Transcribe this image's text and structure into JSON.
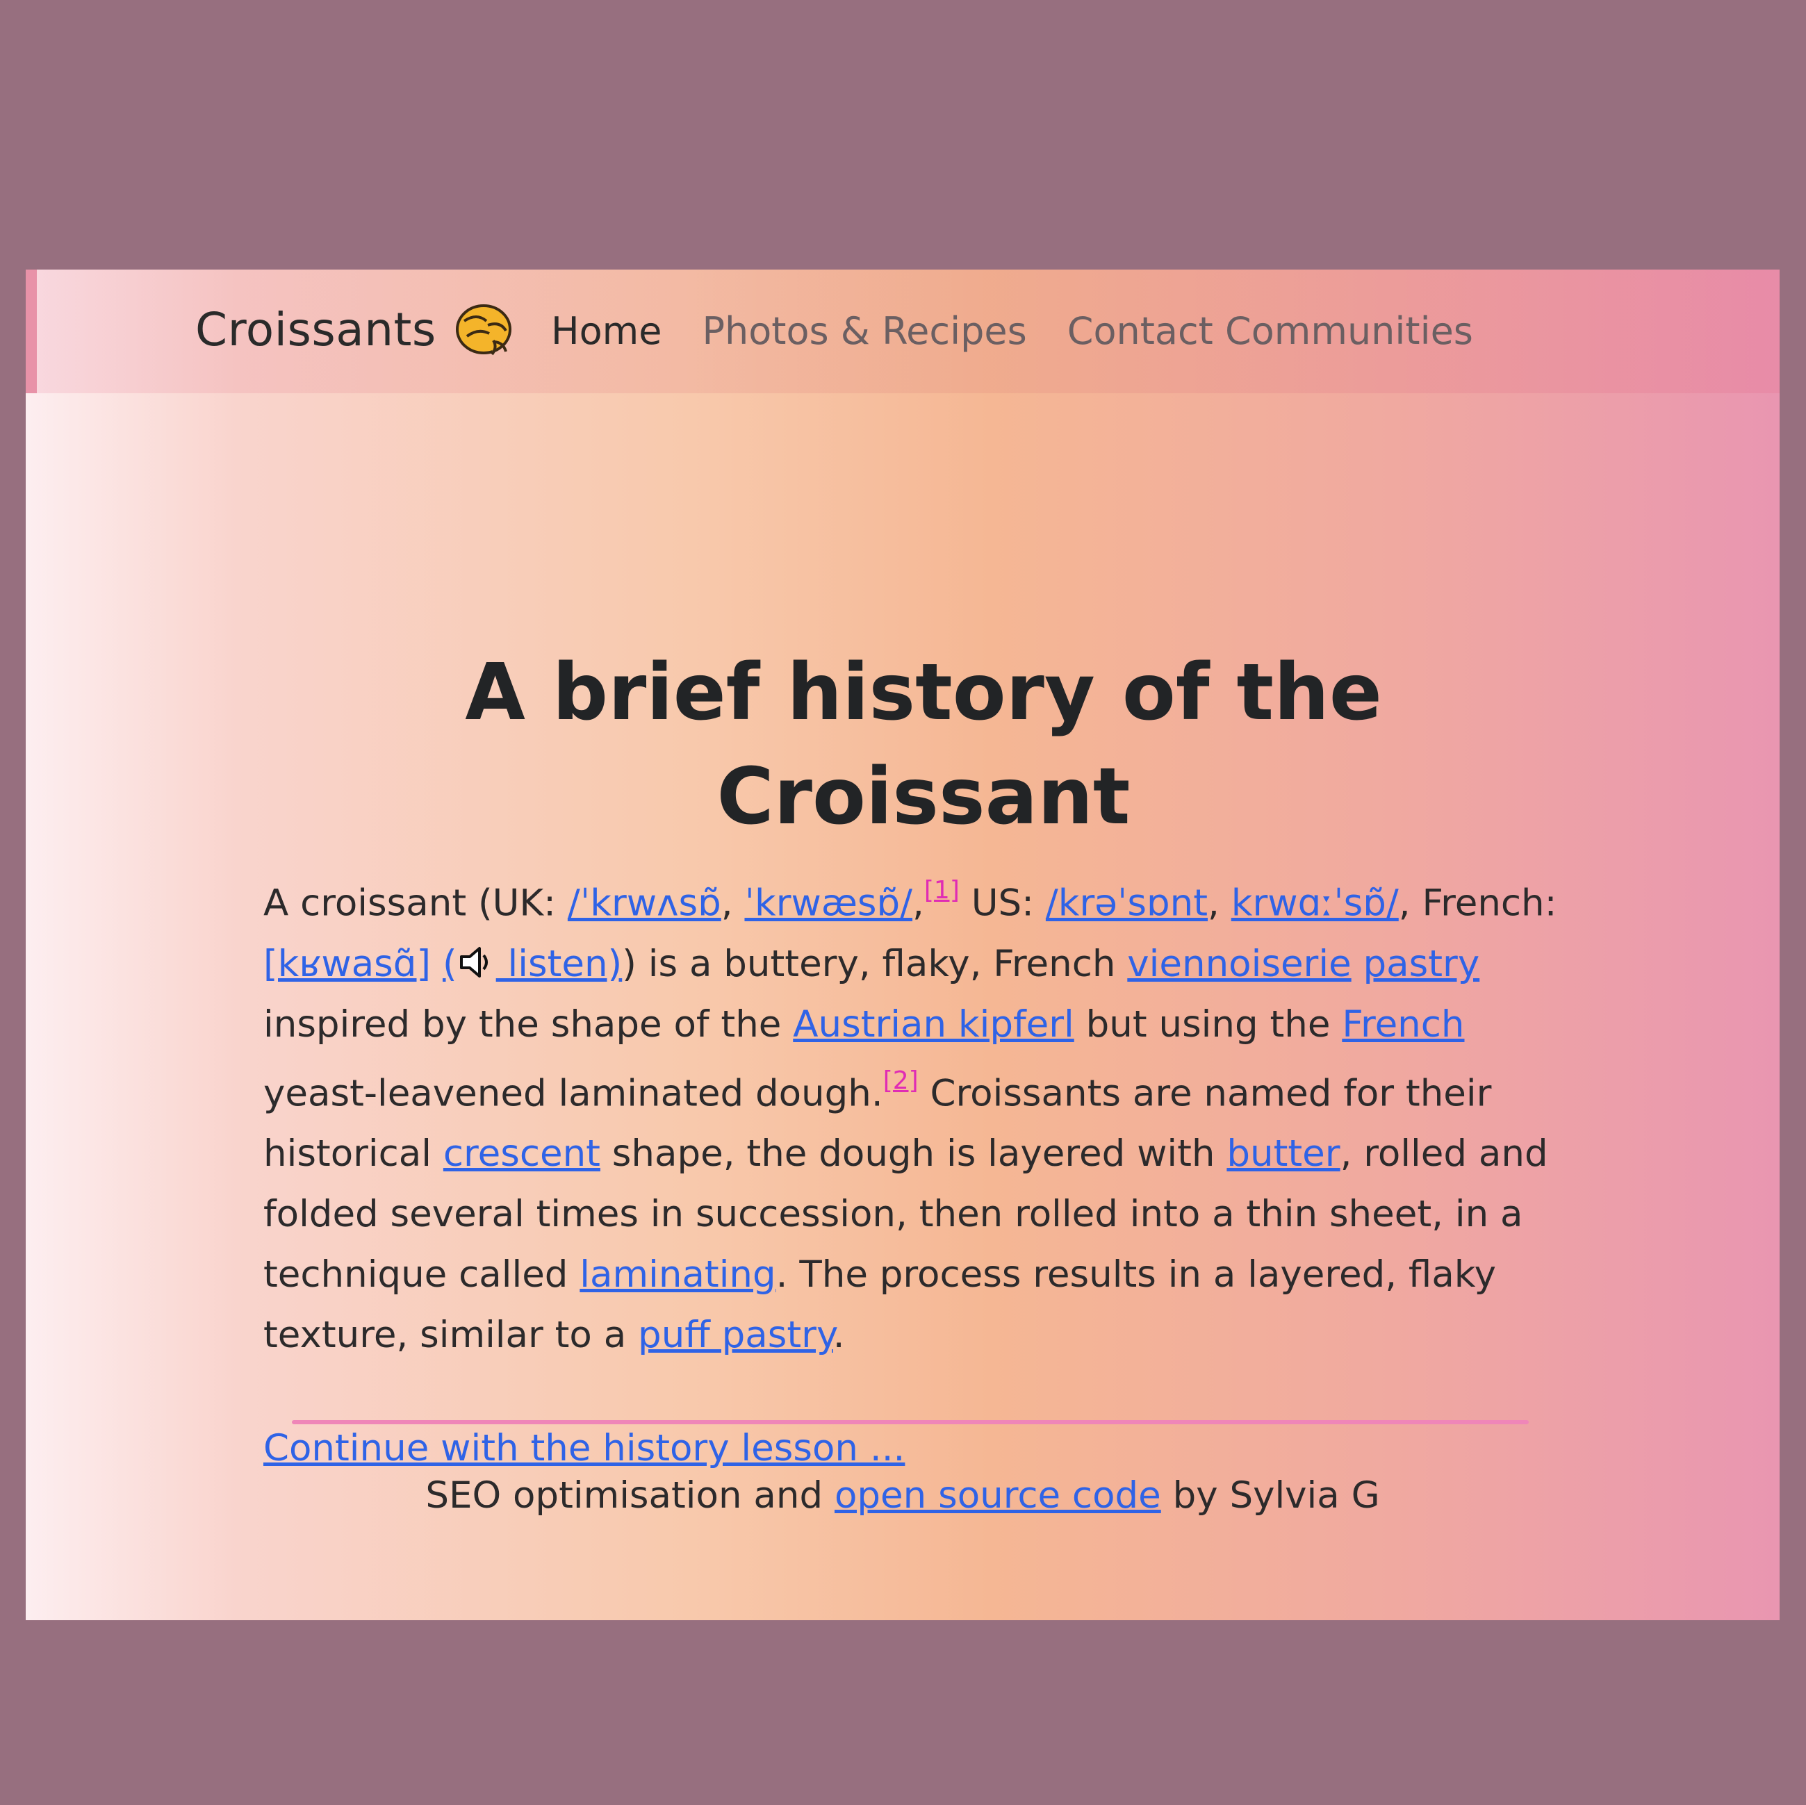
{
  "navbar": {
    "brand": "Croissants",
    "brand_icon": "croissant-icon",
    "links": [
      {
        "label": "Home",
        "active": true
      },
      {
        "label": "Photos & Recipes",
        "active": false
      },
      {
        "label": "Contact Communities",
        "active": false
      }
    ]
  },
  "article": {
    "title": "A brief history of the Croissant",
    "p": {
      "t1": "A croissant (UK: ",
      "l1": "/ˈkrwʌsɒ̃",
      "t2": ", ",
      "l2": "ˈkrwæsɒ̃/",
      "t3": ",",
      "ref1": "[1]",
      "t4": " US: ",
      "l3": "/krəˈsɒnt",
      "t5": ", ",
      "l4": "krwɑːˈsɒ̃/",
      "t6": ", French: ",
      "l5": "[kʁwasɑ̃]",
      "t7": " ",
      "l6a": "(",
      "speaker_icon": "speaker-icon",
      "l6b": " listen)",
      "t8": ") is a buttery, flaky, French ",
      "l7": "viennoiserie",
      "t9": " ",
      "l8": "pastry",
      "t10": " inspired by the shape of the ",
      "l9": "Austrian kipferl",
      "t11": " but using the ",
      "l10": "French",
      "t12": " yeast-leavened laminated dough.",
      "ref2": "[2]",
      "t13": " Croissants are named for their historical ",
      "l11": "crescent",
      "t14": " shape, the dough is layered with ",
      "l12": "butter",
      "t15": ", rolled and folded several times in succession, then rolled into a thin sheet, in a technique called ",
      "l13": "laminating",
      "t16": ". The process results in a layered, flaky texture, similar to a ",
      "l14": "puff pastry",
      "t17": "."
    },
    "continue_link": "Continue with the history lesson ..."
  },
  "footer": {
    "t1": "SEO optimisation and ",
    "link": "open source code",
    "t2": " by Sylvia G"
  },
  "colors": {
    "background": "#976f7f",
    "link": "#2f63e6",
    "ref": "#e02cb4",
    "divider": "#ef86b8"
  }
}
